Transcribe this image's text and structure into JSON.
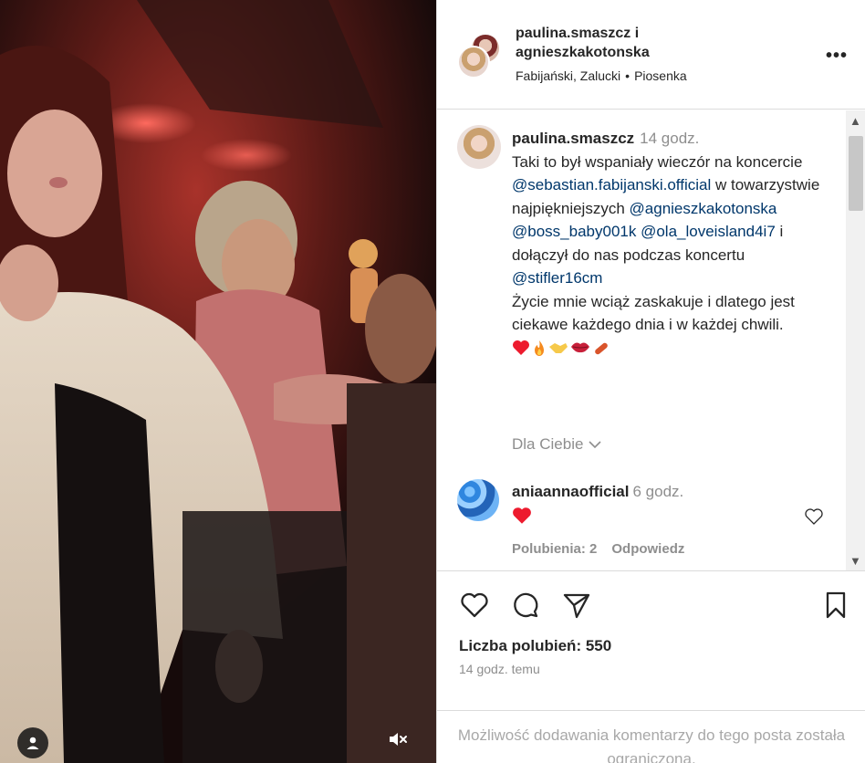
{
  "header": {
    "user_primary": "paulina.smaszcz i",
    "user_secondary": "agnieszkakotonska",
    "audio_artist": "Fabijański, Zalucki",
    "audio_sep": "•",
    "audio_title": "Piosenka",
    "more_label": "•••"
  },
  "caption": {
    "username": "paulina.smaszcz",
    "time": "14 godz.",
    "text_1": "Taki to był wspaniały wieczór na koncercie",
    "mention_1": "@sebastian.fabijanski.official",
    "text_2": "w towarzystwie najpiękniejszych",
    "mention_2": "@agnieszkakotonska",
    "mention_3": "@boss_baby001k",
    "mention_4": "@ola_loveisland4i7",
    "text_3": "i dołączył do nas podczas koncertu",
    "mention_5": "@stifler16cm",
    "text_4": "Życie mnie wciąż zaskakuje i dlatego jest ciekawe każdego dnia i w każdej chwili.",
    "emoji_icons": [
      "heart-emoji",
      "fire-emoji",
      "handshake-emoji",
      "lips-emoji",
      "sausage-emoji"
    ]
  },
  "for_you_label": "Dla Ciebie",
  "comment": {
    "username": "aniaannaofficial",
    "time": "6 godz.",
    "emoji_icon": "heart-emoji",
    "likes_label": "Polubienia: 2",
    "reply_label": "Odpowiedz"
  },
  "likes_text": "Liczba polubień: 550",
  "posted_time": "14 godz. temu",
  "restricted_text": "Możliwość dodawania komentarzy do tego posta została ograniczona.",
  "colors": {
    "mention": "#00376b",
    "secondary_text": "#8e8e8e",
    "heart_red": "#ed1b2e",
    "border": "#dbdbdb"
  }
}
